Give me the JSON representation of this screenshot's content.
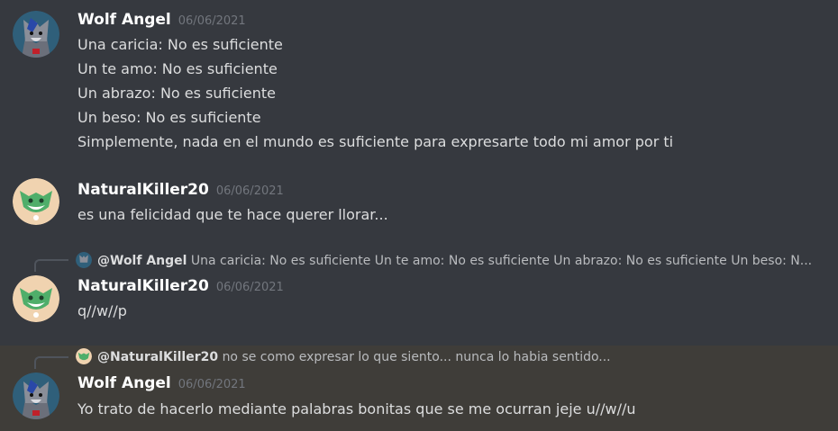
{
  "messages": [
    {
      "author": "Wolf Angel",
      "timestamp": "06/06/2021",
      "lines": [
        "Una caricia: No es suficiente",
        "Un te amo: No es suficiente",
        "Un abrazo: No es suficiente",
        "Un beso: No es suficiente",
        "Simplemente, nada en el mundo es suficiente para expresarte todo mi amor por ti"
      ]
    },
    {
      "author": "NaturalKiller20",
      "timestamp": "06/06/2021",
      "lines": [
        "es una felicidad que te hace querer llorar..."
      ]
    },
    {
      "author": "NaturalKiller20",
      "timestamp": "06/06/2021",
      "reply": {
        "mention": "@Wolf Angel",
        "preview": "Una caricia: No es suficiente Un te amo: No es suficiente Un abrazo: No es suficiente Un beso: N..."
      },
      "lines": [
        "q//w//p"
      ]
    },
    {
      "author": "Wolf Angel",
      "timestamp": "06/06/2021",
      "reply": {
        "mention": "@NaturalKiller20",
        "preview": "no se como expresar lo que siento... nunca lo habia sentido..."
      },
      "lines": [
        "Yo trato de hacerlo mediante palabras bonitas que se me ocurran jeje u//w//u"
      ]
    }
  ],
  "colors": {
    "background": "#36393f",
    "highlight": "#3f3d39",
    "username": "#ffffff",
    "timestamp": "#72767d",
    "text": "#dcddde"
  },
  "icons": {
    "wolf_avatar": "wolf-avatar-icon",
    "natural_avatar": "natural-killer-avatar-icon"
  }
}
